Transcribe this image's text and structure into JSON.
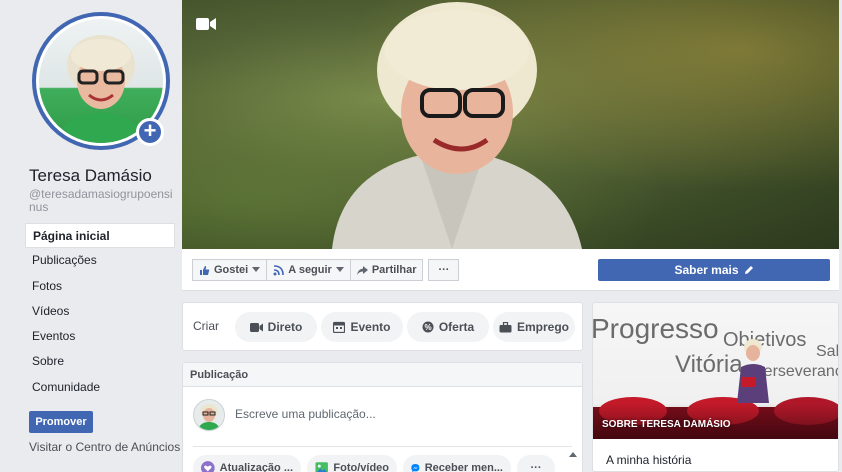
{
  "profile": {
    "name": "Teresa Damásio",
    "handle": "@teresadamasiogrupoensinus"
  },
  "nav": {
    "items": [
      {
        "label": "Página inicial",
        "active": true
      },
      {
        "label": "Publicações"
      },
      {
        "label": "Fotos"
      },
      {
        "label": "Vídeos"
      },
      {
        "label": "Eventos"
      },
      {
        "label": "Sobre"
      },
      {
        "label": "Comunidade"
      }
    ],
    "promote_label": "Promover",
    "ads_center_label": "Visitar o Centro de Anúncios"
  },
  "actions": {
    "like_label": "Gostei",
    "follow_label": "A seguir",
    "share_label": "Partilhar",
    "more_label": "···",
    "learn_more_label": "Saber mais"
  },
  "create": {
    "label": "Criar",
    "buttons": [
      "Direto",
      "Evento",
      "Oferta",
      "Emprego"
    ]
  },
  "publication": {
    "header": "Publicação",
    "placeholder": "Escreve uma publicação...",
    "buttons": [
      "Atualização ...",
      "Foto/vídeo",
      "Receber men...",
      "···"
    ]
  },
  "about": {
    "image_label": "SOBRE TERESA DAMÁSIO",
    "title": "A minha história",
    "wall_words": [
      "Progresso",
      "Objetivos",
      "Vitória",
      "Sabe",
      "Perseverança"
    ]
  },
  "colors": {
    "brand_blue": "#4267b2",
    "page_bg": "#e9ebee"
  }
}
